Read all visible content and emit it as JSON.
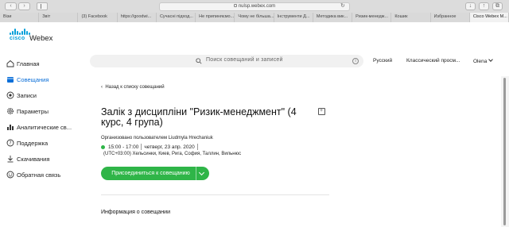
{
  "browser": {
    "url": "nulsp.webex.com",
    "tabs": [
      "Візи",
      "Звіт",
      "(3) Facebook",
      "https://goodwi...",
      "Сучасні підход...",
      "Не припиняємо...",
      "Чому не більша...",
      "Інструменти Д...",
      "Методика вик...",
      "Ризик-менедж...",
      "Кошик",
      "Избранное",
      "Cisco Webex M..."
    ],
    "active_tab_index": 12
  },
  "logo": {
    "brand": "cisco",
    "product": "Webex"
  },
  "sidebar": {
    "items": [
      {
        "label": "Главная",
        "icon": "home-icon"
      },
      {
        "label": "Совещания",
        "icon": "calendar-icon"
      },
      {
        "label": "Записи",
        "icon": "record-icon"
      },
      {
        "label": "Параметры",
        "icon": "gear-icon"
      },
      {
        "label": "Аналитические св...",
        "icon": "analytics-icon"
      },
      {
        "label": "Поддержка",
        "icon": "help-icon"
      },
      {
        "label": "Скачивания",
        "icon": "download-icon"
      },
      {
        "label": "Обратная связь",
        "icon": "feedback-icon"
      }
    ],
    "active_index": 1
  },
  "header": {
    "search_placeholder": "Поиск совещаний и записей",
    "language": "Русский",
    "view_mode": "Классический просм...",
    "user": "Olena"
  },
  "meeting": {
    "back_link": "Назад к списку совещаний",
    "title": "Залік з дисципліни \"Ризик-менеджмент\" (4 курс, 4 група)",
    "organizer": "Организовано пользователем Liudmyla Hrechaniuk",
    "time": "15:00 - 17:00",
    "date": "четверг, 23 апр. 2020",
    "timezone": "(UTC+03:00) Хельсинки, Киев, Рига, София, Таллин, Вильнюс",
    "join_button": "Присоединиться к совещанию",
    "info_heading": "Информация о совещании"
  },
  "colors": {
    "accent_blue": "#0b6fd8",
    "cisco_blue": "#049fd9",
    "join_green": "#2fb548"
  }
}
